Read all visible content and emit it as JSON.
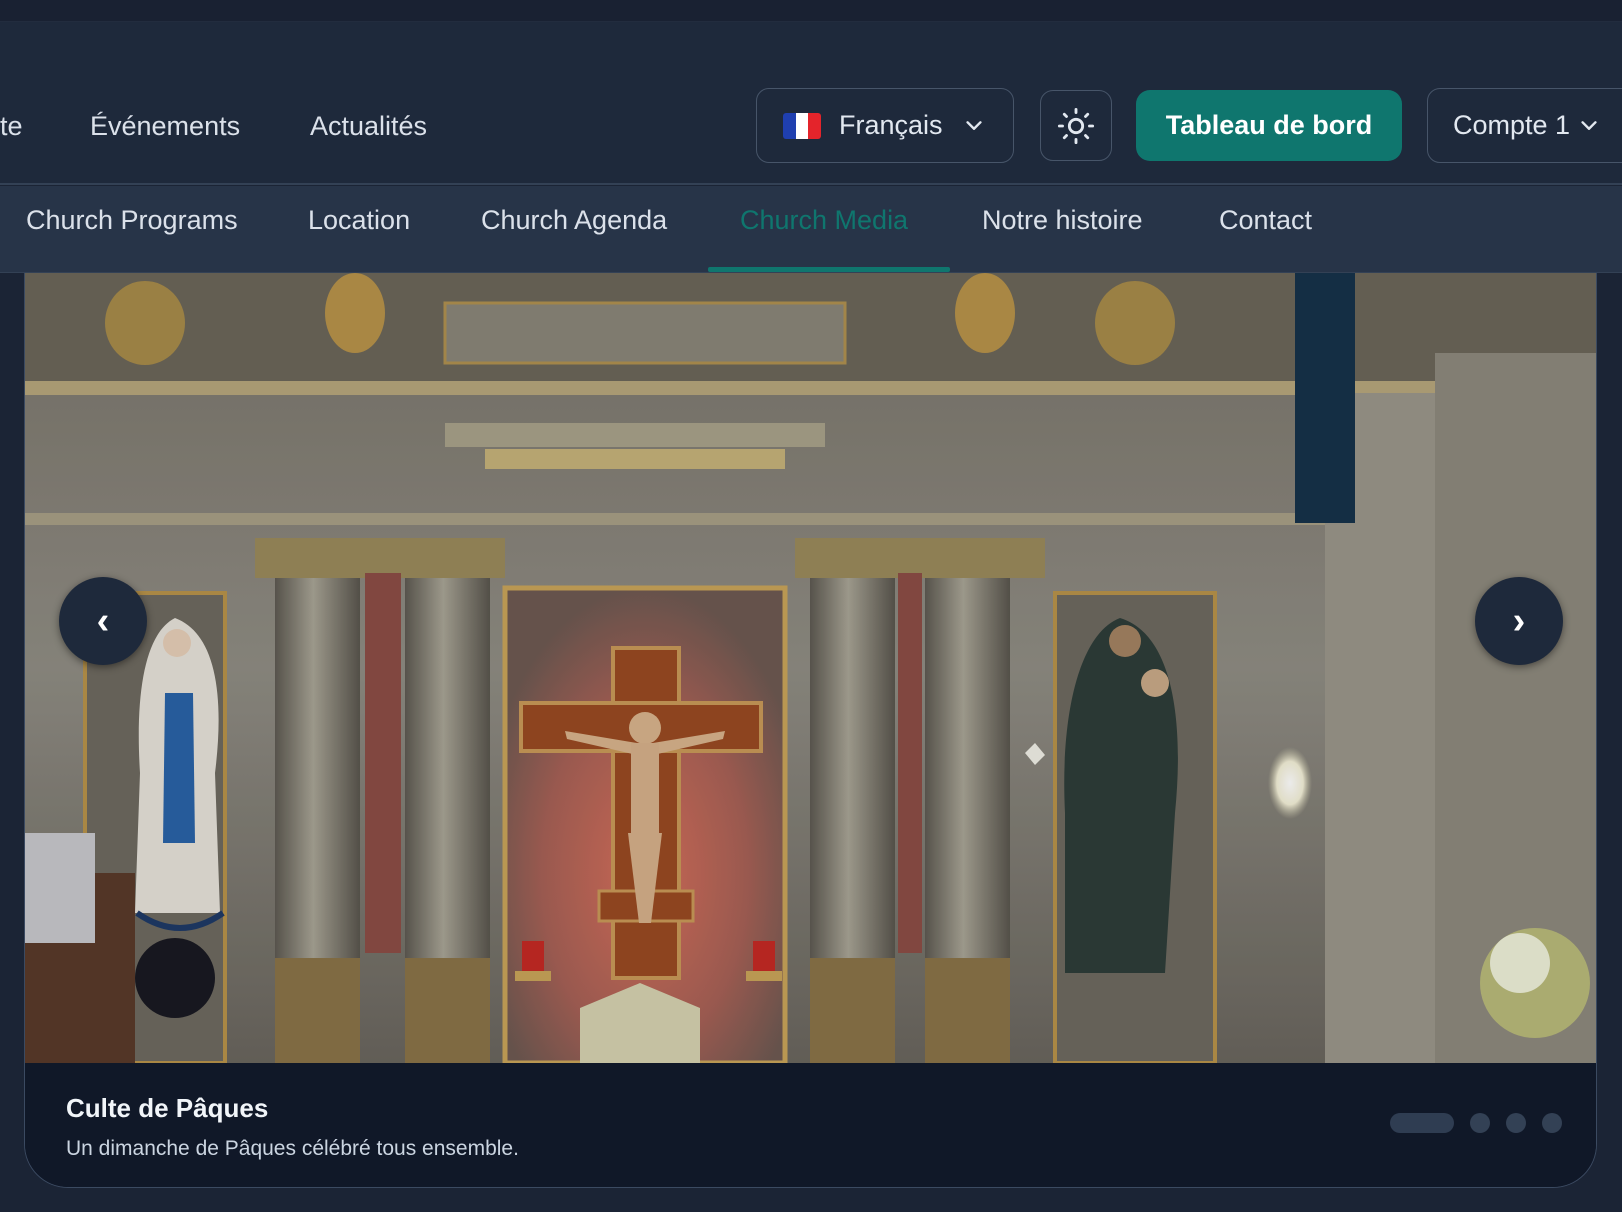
{
  "nav": {
    "items": [
      {
        "label": "te"
      },
      {
        "label": "Événements"
      },
      {
        "label": "Actualités"
      }
    ]
  },
  "language": {
    "selected": "Français",
    "flag_colors": [
      "#1f3fb0",
      "#ffffff",
      "#e4242b"
    ]
  },
  "theme_toggle": {
    "icon": "sun-icon"
  },
  "dashboard_button": {
    "label": "Tableau de bord",
    "color": "#0f766e"
  },
  "account": {
    "label": "Compte 1"
  },
  "subnav": {
    "tabs": [
      {
        "label": "Church Programs"
      },
      {
        "label": "Location"
      },
      {
        "label": "Church Agenda"
      },
      {
        "label": "Church Media",
        "active": true
      },
      {
        "label": "Notre histoire"
      },
      {
        "label": "Contact"
      }
    ],
    "accent": "#0f766e"
  },
  "carousel": {
    "prev_symbol": "‹",
    "next_symbol": "›",
    "current_slide": 1,
    "slide_count": 4,
    "caption": {
      "title": "Culte de Pâques",
      "description": "Un dimanche de Pâques célébré tous ensemble."
    }
  }
}
